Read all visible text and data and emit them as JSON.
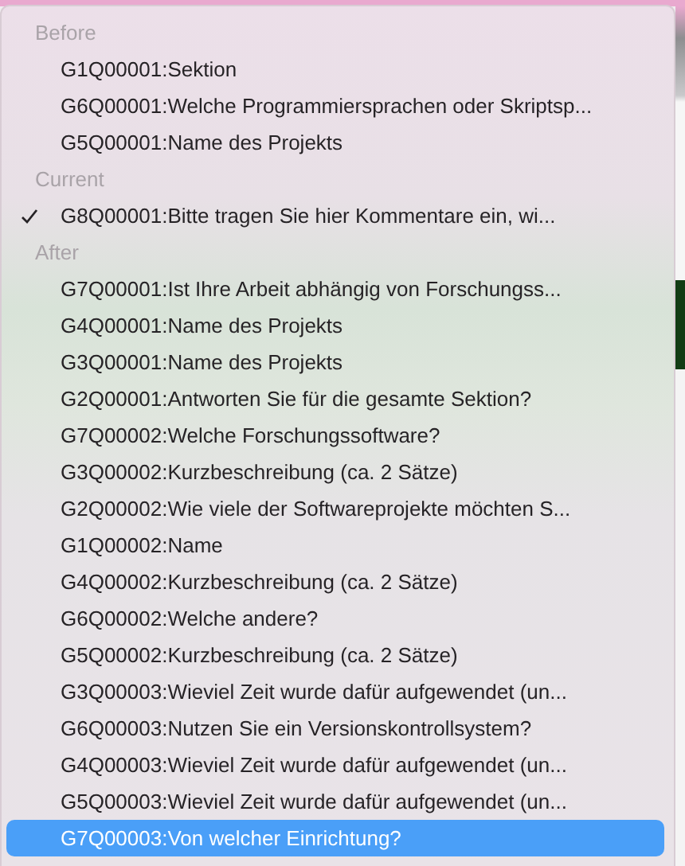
{
  "menu": {
    "sections": [
      {
        "header": "Before",
        "items": [
          {
            "label": "G1Q00001:Sektion",
            "checked": false,
            "selected": false
          },
          {
            "label": "G6Q00001:Welche Programmiersprachen oder Skriptsp...",
            "checked": false,
            "selected": false
          },
          {
            "label": "G5Q00001:Name des Projekts",
            "checked": false,
            "selected": false
          }
        ]
      },
      {
        "header": "Current",
        "items": [
          {
            "label": "G8Q00001:Bitte tragen Sie hier Kommentare ein, wi...",
            "checked": true,
            "selected": false
          }
        ]
      },
      {
        "header": "After",
        "items": [
          {
            "label": "G7Q00001:Ist Ihre Arbeit abhängig von Forschungss...",
            "checked": false,
            "selected": false
          },
          {
            "label": "G4Q00001:Name des Projekts",
            "checked": false,
            "selected": false
          },
          {
            "label": "G3Q00001:Name des Projekts",
            "checked": false,
            "selected": false
          },
          {
            "label": "G2Q00001:Antworten Sie für die gesamte Sektion?",
            "checked": false,
            "selected": false
          },
          {
            "label": "G7Q00002:Welche Forschungssoftware?",
            "checked": false,
            "selected": false
          },
          {
            "label": "G3Q00002:Kurzbeschreibung (ca. 2 Sätze)",
            "checked": false,
            "selected": false
          },
          {
            "label": "G2Q00002:Wie viele der Softwareprojekte möchten S...",
            "checked": false,
            "selected": false
          },
          {
            "label": "G1Q00002:Name",
            "checked": false,
            "selected": false
          },
          {
            "label": "G4Q00002:Kurzbeschreibung (ca. 2 Sätze)",
            "checked": false,
            "selected": false
          },
          {
            "label": "G6Q00002:Welche andere?",
            "checked": false,
            "selected": false
          },
          {
            "label": "G5Q00002:Kurzbeschreibung (ca. 2 Sätze)",
            "checked": false,
            "selected": false
          },
          {
            "label": "G3Q00003:Wieviel Zeit wurde dafür aufgewendet (un...",
            "checked": false,
            "selected": false
          },
          {
            "label": "G6Q00003:Nutzen Sie ein Versionskontrollsystem?",
            "checked": false,
            "selected": false
          },
          {
            "label": "G4Q00003:Wieviel Zeit wurde dafür aufgewendet (un...",
            "checked": false,
            "selected": false
          },
          {
            "label": "G5Q00003:Wieviel Zeit wurde dafür aufgewendet (un...",
            "checked": false,
            "selected": false
          },
          {
            "label": "G7Q00003:Von welcher Einrichtung?",
            "checked": false,
            "selected": true
          }
        ]
      }
    ]
  }
}
